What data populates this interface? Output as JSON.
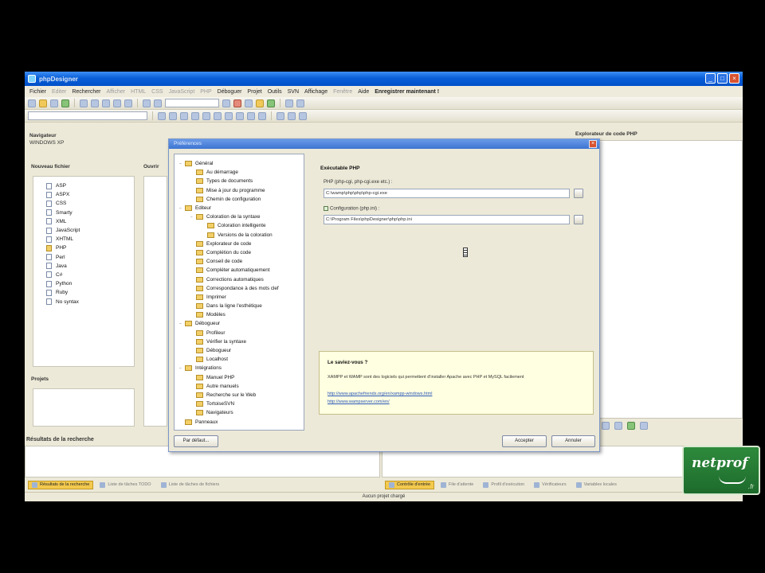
{
  "window": {
    "title": "phpDesigner"
  },
  "menu": [
    {
      "label": "Fichier",
      "state": "normal"
    },
    {
      "label": "Editer",
      "state": "dim"
    },
    {
      "label": "Rechercher",
      "state": "normal"
    },
    {
      "label": "Afficher",
      "state": "dim"
    },
    {
      "label": "HTML",
      "state": "dim"
    },
    {
      "label": "CSS",
      "state": "dim"
    },
    {
      "label": "JavaScript",
      "state": "dim"
    },
    {
      "label": "PHP",
      "state": "dim"
    },
    {
      "label": "Déboguer",
      "state": "normal"
    },
    {
      "label": "Projet",
      "state": "normal"
    },
    {
      "label": "Outils",
      "state": "normal"
    },
    {
      "label": "SVN",
      "state": "normal"
    },
    {
      "label": "Affichage",
      "state": "normal"
    },
    {
      "label": "Fenêtre",
      "state": "dim"
    },
    {
      "label": "Aide",
      "state": "normal"
    },
    {
      "label": "Enregistrer maintenant !",
      "state": "bold"
    }
  ],
  "panels": {
    "navigation_title": "Navigateur",
    "navigation_sub": "WINDOWS XP",
    "new_file_title": "Nouveau fichier",
    "projects_title": "Projets",
    "outline_title": "Ouvrir",
    "php_code_title": "Explorateur de code PHP",
    "results_title": "Résultats de la recherche"
  },
  "new_files": [
    {
      "label": "ASP",
      "type": "file"
    },
    {
      "label": "ASPX",
      "type": "file"
    },
    {
      "label": "CSS",
      "type": "file"
    },
    {
      "label": "Smarty",
      "type": "file"
    },
    {
      "label": "XML",
      "type": "file"
    },
    {
      "label": "JavaScript",
      "type": "file"
    },
    {
      "label": "XHTML",
      "type": "file"
    },
    {
      "label": "PHP",
      "type": "folder"
    },
    {
      "label": "Perl",
      "type": "file"
    },
    {
      "label": "Java",
      "type": "file"
    },
    {
      "label": "C#",
      "type": "file"
    },
    {
      "label": "Python",
      "type": "file"
    },
    {
      "label": "Ruby",
      "type": "file"
    },
    {
      "label": "No syntax",
      "type": "file"
    }
  ],
  "dialog": {
    "title": "Préférences",
    "close": "×",
    "tree": [
      {
        "label": "Général",
        "level": 0,
        "expand": "−"
      },
      {
        "label": "Au démarrage",
        "level": 1
      },
      {
        "label": "Types de documents",
        "level": 1
      },
      {
        "label": "Mise à jour du programme",
        "level": 1
      },
      {
        "label": "Chemin de configuration",
        "level": 1
      },
      {
        "label": "Editeur",
        "level": 0,
        "expand": "−"
      },
      {
        "label": "Coloration de la syntaxe",
        "level": 1,
        "expand": "−"
      },
      {
        "label": "Coloration intelligente",
        "level": 2
      },
      {
        "label": "Versions de la coloration",
        "level": 2
      },
      {
        "label": "Explorateur de code",
        "level": 1
      },
      {
        "label": "Complétion du code",
        "level": 1
      },
      {
        "label": "Conseil de code",
        "level": 1
      },
      {
        "label": "Compléter automatiquement",
        "level": 1
      },
      {
        "label": "Corrections automatiques",
        "level": 1
      },
      {
        "label": "Correspondance à des mots clef",
        "level": 1
      },
      {
        "label": "Imprimer",
        "level": 1
      },
      {
        "label": "Dans la ligne l'esthétique",
        "level": 1
      },
      {
        "label": "Modèles",
        "level": 1
      },
      {
        "label": "Débogueur",
        "level": 0,
        "expand": "−"
      },
      {
        "label": "Profileur",
        "level": 1
      },
      {
        "label": "Vérifier la syntaxe",
        "level": 1
      },
      {
        "label": "Débogueur",
        "level": 1
      },
      {
        "label": "Localhost",
        "level": 1
      },
      {
        "label": "Intégrations",
        "level": 0,
        "expand": "−"
      },
      {
        "label": "Manuel PHP",
        "level": 1
      },
      {
        "label": "Autre manuels",
        "level": 1
      },
      {
        "label": "Recherche sur le Web",
        "level": 1
      },
      {
        "label": "TortoiseSVN",
        "level": 1
      },
      {
        "label": "Navigateurs",
        "level": 1
      },
      {
        "label": "Panneaux",
        "level": 0
      }
    ],
    "section_title": "Exécutable PHP",
    "php_label": "PHP (php-cgi, php-cgi.exe etc.) :",
    "php_value": "C:\\wamp\\php\\php\\php-cgi.exe",
    "config_label": "Configuration (php.ini) :",
    "config_value": "C:\\Program Files\\phpDesigner\\php\\php.ini",
    "info_title": "Le saviez-vous ?",
    "info_text": "XAMPP et WAMP sont des logiciels qui permettent d'installer Apache avec PHP et MySQL facilement",
    "link1": "http://www.apachefriends.org/en/xampp-windows.html",
    "link2": "http://www.wampserver.com/en/",
    "btn_default": "Par défaut...",
    "btn_ok": "Accepter",
    "btn_cancel": "Annuler"
  },
  "bottom_tabs_left": [
    {
      "label": "Résultats de la recherche",
      "active": true
    },
    {
      "label": "Liste de tâches TODO",
      "active": false
    },
    {
      "label": "Liste de tâches de fichiers",
      "active": false
    }
  ],
  "bottom_tabs_right": [
    {
      "label": "Contrôle d'entrée",
      "active": true
    },
    {
      "label": "File d'attente",
      "active": false
    },
    {
      "label": "Profil d'exécution",
      "active": false
    },
    {
      "label": "Vérificateurs",
      "active": false
    },
    {
      "label": "Variables locales",
      "active": false
    }
  ],
  "status": "Aucun projet chargé",
  "logo": {
    "text": "netprof",
    "sub": ".fr"
  },
  "colors": {
    "titlebar": "#0a5fd8",
    "accent_tab": "#f3c94e",
    "logo_bg": "#2e8a3c"
  }
}
